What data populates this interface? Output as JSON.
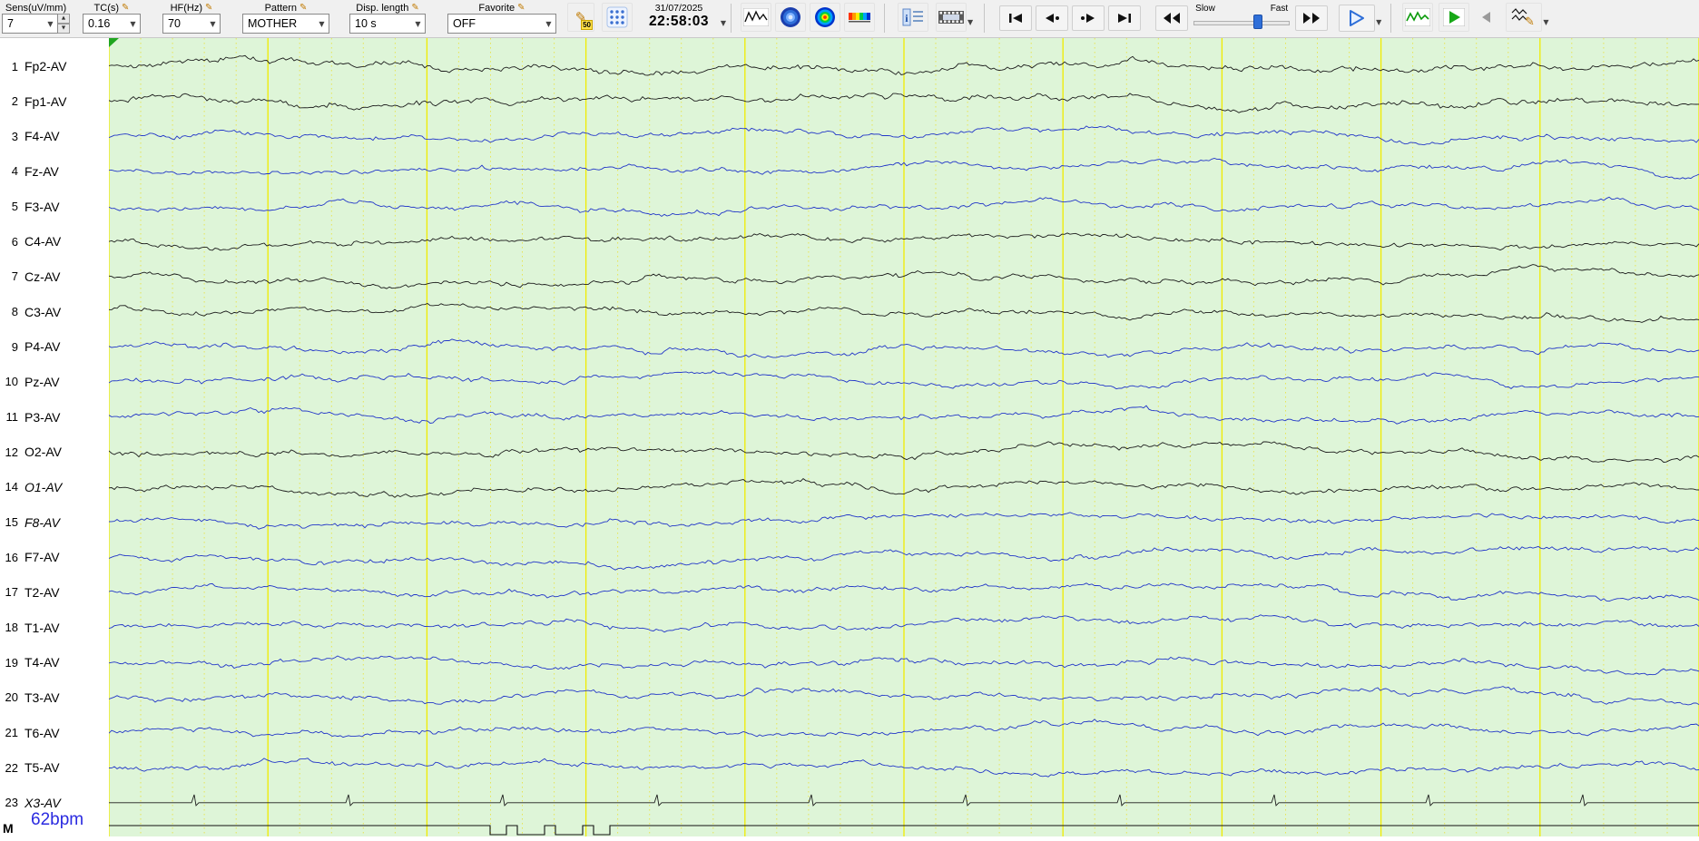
{
  "toolbar": {
    "sens": {
      "label": "Sens(uV/mm)",
      "value": "7"
    },
    "tc": {
      "label": "TC(s)",
      "value": "0.16"
    },
    "hf": {
      "label": "HF(Hz)",
      "value": "70"
    },
    "pattern": {
      "label": "Pattern",
      "value": "MOTHER"
    },
    "disp_length": {
      "label": "Disp. length",
      "value": "10 s"
    },
    "favorite": {
      "label": "Favorite",
      "value": "OFF"
    },
    "notch": "50",
    "date": "31/07/2025",
    "time": "22:58:03",
    "slow": "Slow",
    "fast": "Fast"
  },
  "channels": [
    {
      "num": "1",
      "label": "Fp2-AV",
      "color": "black",
      "italic": false,
      "kind": "eeg"
    },
    {
      "num": "2",
      "label": "Fp1-AV",
      "color": "black",
      "italic": false,
      "kind": "eeg"
    },
    {
      "num": "3",
      "label": "F4-AV",
      "color": "blue",
      "italic": false,
      "kind": "eeg"
    },
    {
      "num": "4",
      "label": "Fz-AV",
      "color": "blue",
      "italic": false,
      "kind": "eeg"
    },
    {
      "num": "5",
      "label": "F3-AV",
      "color": "blue",
      "italic": false,
      "kind": "eeg"
    },
    {
      "num": "6",
      "label": "C4-AV",
      "color": "black",
      "italic": false,
      "kind": "eeg"
    },
    {
      "num": "7",
      "label": "Cz-AV",
      "color": "black",
      "italic": false,
      "kind": "eeg"
    },
    {
      "num": "8",
      "label": "C3-AV",
      "color": "black",
      "italic": false,
      "kind": "eeg"
    },
    {
      "num": "9",
      "label": "P4-AV",
      "color": "blue",
      "italic": false,
      "kind": "eeg"
    },
    {
      "num": "10",
      "label": "Pz-AV",
      "color": "blue",
      "italic": false,
      "kind": "eeg"
    },
    {
      "num": "11",
      "label": "P3-AV",
      "color": "blue",
      "italic": false,
      "kind": "eeg"
    },
    {
      "num": "12",
      "label": "O2-AV",
      "color": "black",
      "italic": false,
      "kind": "eeg"
    },
    {
      "num": "14",
      "label": "O1-AV",
      "color": "black",
      "italic": true,
      "kind": "eeg"
    },
    {
      "num": "15",
      "label": "F8-AV",
      "color": "blue",
      "italic": true,
      "kind": "eeg"
    },
    {
      "num": "16",
      "label": "F7-AV",
      "color": "blue",
      "italic": false,
      "kind": "eeg"
    },
    {
      "num": "17",
      "label": "T2-AV",
      "color": "blue",
      "italic": false,
      "kind": "eeg"
    },
    {
      "num": "18",
      "label": "T1-AV",
      "color": "blue",
      "italic": false,
      "kind": "eeg"
    },
    {
      "num": "19",
      "label": "T4-AV",
      "color": "blue",
      "italic": false,
      "kind": "eeg"
    },
    {
      "num": "20",
      "label": "T3-AV",
      "color": "blue",
      "italic": false,
      "kind": "eeg"
    },
    {
      "num": "21",
      "label": "T6-AV",
      "color": "blue",
      "italic": false,
      "kind": "eeg"
    },
    {
      "num": "22",
      "label": "T5-AV",
      "color": "blue",
      "italic": false,
      "kind": "eeg"
    },
    {
      "num": "23",
      "label": "X3-AV",
      "color": "black",
      "italic": true,
      "kind": "ecg"
    }
  ],
  "heart_rate": "62bpm",
  "marker_label": "M",
  "colors": {
    "trace_black": "#1c1c1c",
    "trace_blue": "#2236c8",
    "bg": "#def5d8",
    "grid_major": "#f0ec00",
    "grid_minor": "#e8e455",
    "accent_blue": "#2f6fd8"
  }
}
